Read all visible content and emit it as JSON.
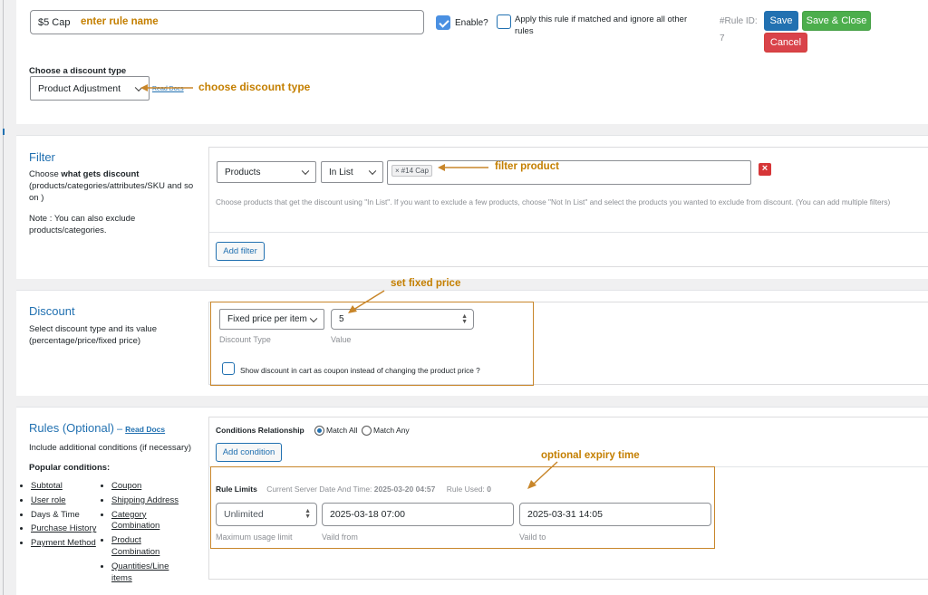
{
  "rule": {
    "name_value": "$5 Cap",
    "annot_name": "enter rule name",
    "enable_label": "Enable?",
    "apply_label": "Apply this rule if matched and ignore all other rules",
    "rule_id_label": "#Rule ID:",
    "rule_id_value": "7",
    "save_label": "Save",
    "save_close_label": "Save & Close",
    "cancel_label": "Cancel"
  },
  "discount_type": {
    "label": "Choose a discount type",
    "selected": "Product Adjustment",
    "docs_link": "Read Docs",
    "annot": "choose discount type"
  },
  "filter": {
    "heading": "Filter",
    "desc_prefix": "Choose ",
    "desc_bold": "what gets discount",
    "desc_rest": " (products/categories/attributes/SKU and so on )",
    "note": "Note : You can also exclude products/categories.",
    "type_selected": "Products",
    "op_selected": "In List",
    "tag": "#14 Cap",
    "tag_remove": "×",
    "annot": "filter product",
    "help": "Choose products that get the discount using \"In List\". If you want to exclude a few products, choose \"Not In List\" and select the products you wanted to exclude from discount. (You can add multiple filters)",
    "add_filter_label": "Add filter"
  },
  "discount": {
    "heading": "Discount",
    "desc": "Select discount type and its value (percentage/price/fixed price)",
    "type_selected": "Fixed price per item",
    "value": "5",
    "type_caption": "Discount Type",
    "value_caption": "Value",
    "coupon_label": "Show discount in cart as coupon instead of changing the product price ?",
    "annot": "set fixed price"
  },
  "rules": {
    "heading": "Rules (Optional)",
    "dash": " – ",
    "docs_link": "Read Docs",
    "desc": "Include additional conditions (if necessary)",
    "popular": "Popular conditions:",
    "col1": [
      "Subtotal",
      "User role",
      "Days & Time",
      "Purchase History",
      "Payment Method"
    ],
    "col2": [
      "Coupon",
      "Shipping Address",
      "Category Combination",
      "Product Combination",
      "Quantities/Line items"
    ],
    "relationship_label": "Conditions Relationship",
    "match_all": "Match All",
    "match_any": "Match Any",
    "add_condition_label": "Add condition",
    "annot": "optional expiry time"
  },
  "limits": {
    "title": "Rule Limits",
    "server_time_label": "Current Server Date And Time:",
    "server_time_value": "2025-03-20 04:57",
    "used_label": "Rule Used:",
    "used_value": "0",
    "usage_value": "Unlimited",
    "valid_from": "2025-03-18 07:00",
    "valid_to": "2025-03-31 14:05",
    "usage_caption": "Maximum usage limit",
    "from_caption": "Vaild from",
    "to_caption": "Vaild to"
  },
  "colors": {
    "accent": "#2271b1",
    "annotation": "#c47f00",
    "save_close": "#4cae4c",
    "cancel": "#d9434a"
  }
}
